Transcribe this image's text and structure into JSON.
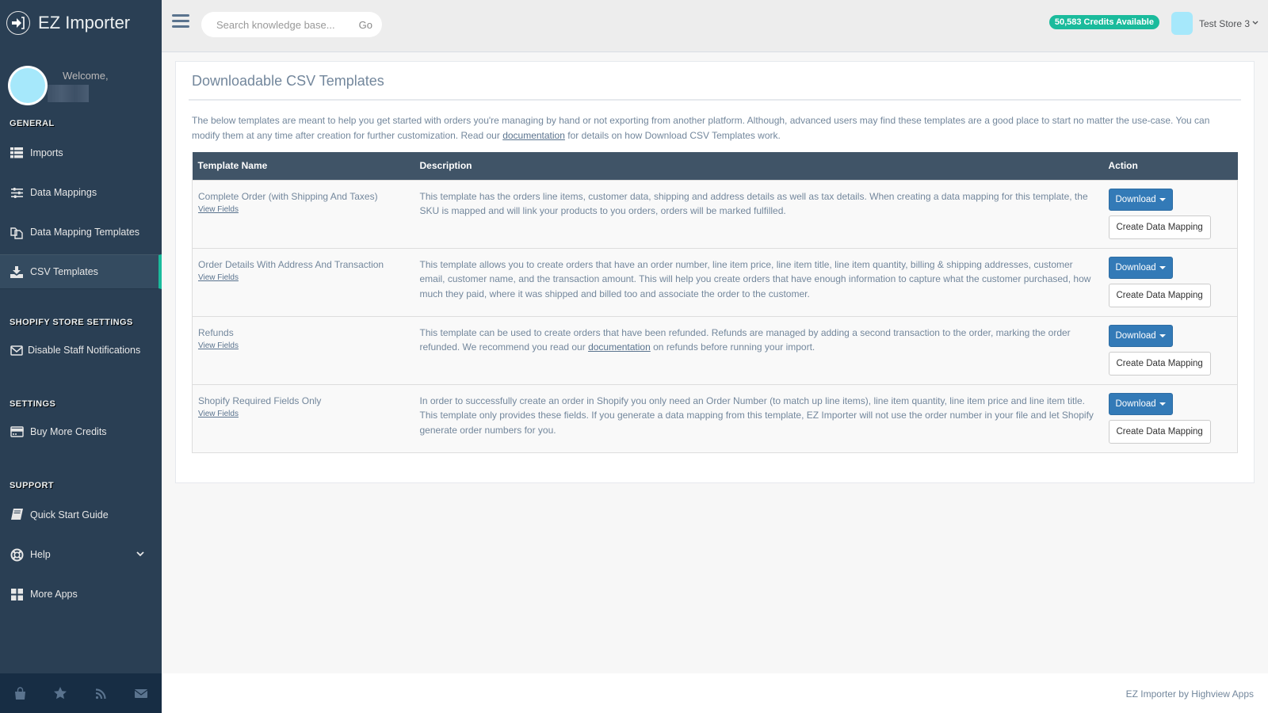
{
  "app": {
    "title": "EZ Importer"
  },
  "profile": {
    "welcome": "Welcome,"
  },
  "sidebar": {
    "sections": [
      {
        "title": "GENERAL",
        "items": [
          {
            "label": "Imports",
            "icon": "list-icon"
          },
          {
            "label": "Data Mappings",
            "icon": "sliders-icon"
          },
          {
            "label": "Data Mapping Templates",
            "icon": "copy-icon"
          },
          {
            "label": "CSV Templates",
            "icon": "download-icon",
            "active": true
          }
        ]
      },
      {
        "title": "SHOPIFY STORE SETTINGS",
        "items": [
          {
            "label": "Disable Staff Notifications",
            "icon": "envelope-icon"
          }
        ]
      },
      {
        "title": "SETTINGS",
        "items": [
          {
            "label": "Buy More Credits",
            "icon": "credit-card-icon"
          }
        ]
      },
      {
        "title": "SUPPORT",
        "items": [
          {
            "label": "Quick Start Guide",
            "icon": "book-icon"
          },
          {
            "label": "Help",
            "icon": "life-ring-icon",
            "has_chevron": true
          },
          {
            "label": "More Apps",
            "icon": "grid-icon"
          }
        ]
      }
    ],
    "footer_icons": [
      "shopping-bag-icon",
      "star-icon",
      "rss-icon",
      "envelope-icon"
    ]
  },
  "topnav": {
    "search_placeholder": "Search knowledge base...",
    "search_go": "Go",
    "credits": "50,583 Credits Available",
    "store_name": "Test Store 3",
    "accent_color": "#1abb9c"
  },
  "main": {
    "title": "Downloadable CSV Templates",
    "intro_before": "The below templates are meant to help you get started with orders you're managing by hand or not exporting from another platform. Although, advanced users may find these templates are a good place to start no matter the use-case. You can modify them at any time after creation for further customization. Read our ",
    "intro_link": "documentation",
    "intro_after": " for details on how Download CSV Templates work.",
    "table": {
      "headers": [
        "Template Name",
        "Description",
        "Action"
      ],
      "view_fields_label": "View Fields",
      "download_label": "Download",
      "create_label": "Create Data Mapping",
      "rows": [
        {
          "name": "Complete Order (with Shipping And Taxes)",
          "description": "This template has the orders line items, customer data, shipping and address details as well as tax details. When creating a data mapping for this template, the SKU is mapped and will link your products to you orders, orders will be marked fulfilled.",
          "desc_link": "",
          "desc_after": ""
        },
        {
          "name": "Order Details With Address And Transaction",
          "description": "This template allows you to create orders that have an order number, line item price, line item title, line item quantity, billing & shipping addresses, customer email, customer name, and the transaction amount. This will help you create orders that have enough information to capture what the customer purchased, how much they paid, where it was shipped and billed too and associate the order to the customer.",
          "desc_link": "",
          "desc_after": ""
        },
        {
          "name": "Refunds",
          "description": "This template can be used to create orders that have been refunded. Refunds are managed by adding a second transaction to the order, marking the order refunded. We recommend you read our ",
          "desc_link": "documentation",
          "desc_after": " on refunds before running your import."
        },
        {
          "name": "Shopify Required Fields Only",
          "description": "In order to successfully create an order in Shopify you only need an Order Number (to match up line items), line item quantity, line item price and line item title. This template only provides these fields. If you generate a data mapping from this template, EZ Importer will not use the order number in your file and let Shopify generate order numbers for you.",
          "desc_link": "",
          "desc_after": ""
        }
      ]
    }
  },
  "footer": {
    "text": "EZ Importer by Highview Apps"
  }
}
